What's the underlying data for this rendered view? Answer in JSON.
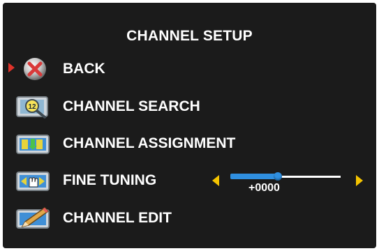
{
  "menu": {
    "title": "CHANNEL SETUP",
    "items": [
      {
        "label": "BACK",
        "icon": "back-x-icon",
        "selected": true
      },
      {
        "label": "CHANNEL SEARCH",
        "icon": "channel-search-icon"
      },
      {
        "label": "CHANNEL ASSIGNMENT",
        "icon": "channel-assignment-icon"
      },
      {
        "label": "FINE TUNING",
        "icon": "fine-tuning-icon"
      },
      {
        "label": "CHANNEL EDIT",
        "icon": "channel-edit-icon"
      }
    ],
    "fine_tuning_value": "+0000",
    "fine_tuning_level": 0.43
  },
  "colors": {
    "background": "#1b1b1b",
    "text": "#ffffff",
    "pointer": "#e0332a",
    "slider_arrow": "#f5c400",
    "slider_fill": "#2f8fe0"
  }
}
